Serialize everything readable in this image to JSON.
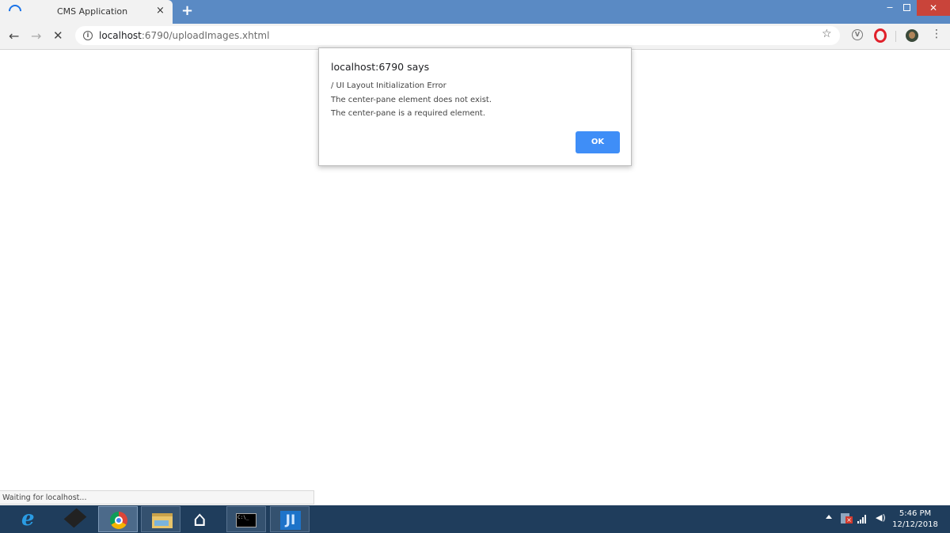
{
  "browser": {
    "tab_title": "CMS Application",
    "tab_close": "×",
    "new_tab": "+",
    "url_host": "localhost",
    "url_path": ":6790/uploadImages.xhtml"
  },
  "window_controls": {
    "minimize": "‒",
    "close": "✕"
  },
  "toolbar": {
    "back": "←",
    "forward": "→",
    "stop": "✕",
    "bookmark_star": "☆",
    "menu": "⋮",
    "info": "i",
    "ext_v": "V"
  },
  "dialog": {
    "title": "localhost:6790 says",
    "lines": [
      " / UI Layout Initialization Error",
      "The center-pane element does not exist.",
      "The center-pane is a required element."
    ],
    "ok_label": "OK"
  },
  "status": {
    "text": "Waiting for localhost..."
  },
  "taskbar": {
    "items": [
      {
        "name": "internet-explorer",
        "label": "e"
      },
      {
        "name": "app-generic"
      },
      {
        "name": "google-chrome"
      },
      {
        "name": "file-explorer"
      },
      {
        "name": "home"
      },
      {
        "name": "command-prompt",
        "label": "C:\\_"
      },
      {
        "name": "intellij-idea",
        "label": "JI"
      }
    ],
    "tray_volume": "◀)",
    "clock_time": "5:46 PM",
    "clock_date": "12/12/2018"
  },
  "colors": {
    "titlebar": "#5a8ac4",
    "taskbar": "#1f3d5c",
    "ok_button": "#3f8ef7",
    "close_button": "#c9443a"
  }
}
